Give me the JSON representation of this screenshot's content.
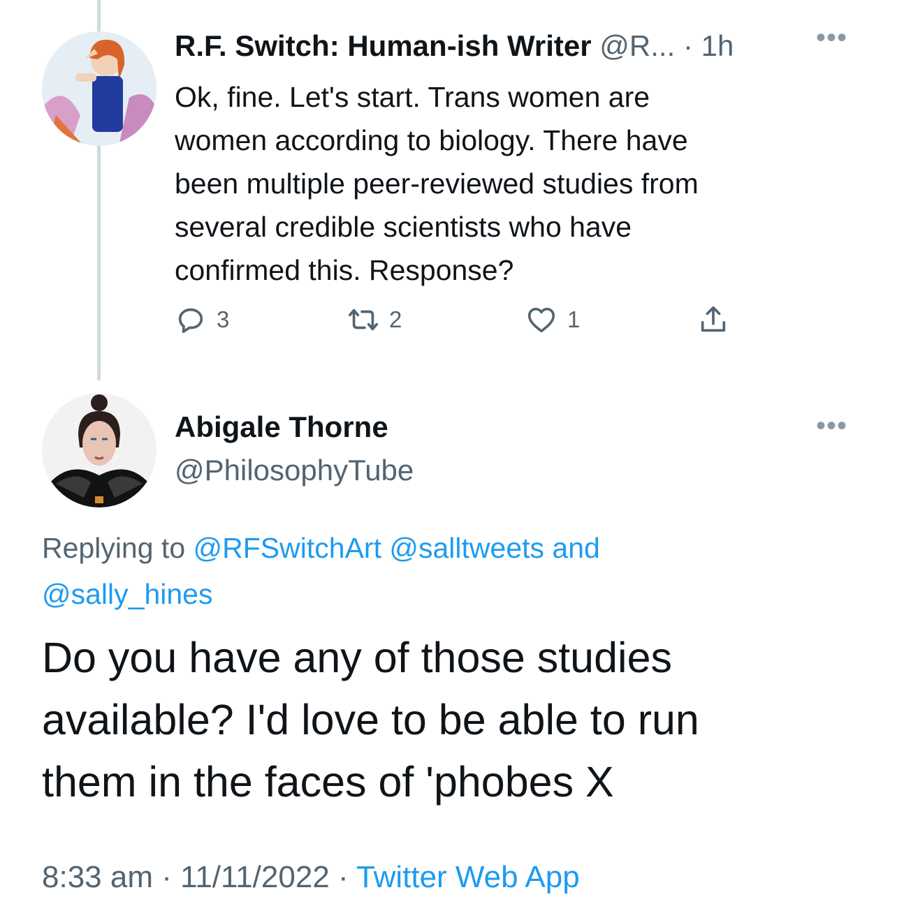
{
  "parent_tweet": {
    "author_name": "R.F. Switch: Human-ish Writer",
    "handle_truncated": "@R...",
    "separator": "·",
    "age": "1h",
    "more_label": "•••",
    "lines": [
      "Ok, fine. Let's start. Trans women are",
      "women according to biology. There have",
      "been multiple peer-reviewed studies from",
      "several credible scientists who have",
      "confirmed this. Response?"
    ],
    "reply_count": "3",
    "retweet_count": "2",
    "like_count": "1"
  },
  "main_tweet": {
    "author_name": "Abigale Thorne",
    "handle": "@PhilosophyTube",
    "more_label": "•••",
    "replying_prefix": "Replying to",
    "mention_1": "@RFSwitchArt",
    "mention_2": "@salltweets",
    "and_word": "and",
    "mention_3": "@sally_hines",
    "lines": [
      "Do you have any of those studies",
      "available? I'd love to be able to run",
      "them in the faces of 'phobes X"
    ],
    "time": "8:33 am",
    "sep1": "·",
    "date": "11/11/2022",
    "sep2": "·",
    "source": "Twitter Web App"
  },
  "colors": {
    "text": "#0f1419",
    "secondary": "#536471",
    "link": "#1d9bf0",
    "thread_line": "#cfd9de"
  },
  "icons": [
    "reply-icon",
    "retweet-icon",
    "like-icon",
    "share-icon",
    "more-icon"
  ]
}
